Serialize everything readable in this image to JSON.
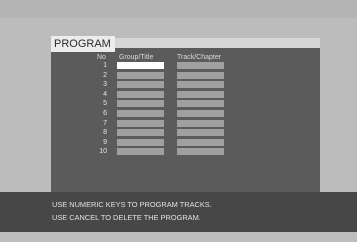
{
  "program": {
    "title": "PROGRAM",
    "columns": {
      "no": "No",
      "group_title": "Group/Title",
      "track_chapter": "Track/Chapter"
    },
    "rows": [
      {
        "no": "1",
        "group_title": "",
        "track_chapter": "",
        "selected": true
      },
      {
        "no": "2",
        "group_title": "",
        "track_chapter": "",
        "selected": false
      },
      {
        "no": "3",
        "group_title": "",
        "track_chapter": "",
        "selected": false
      },
      {
        "no": "4",
        "group_title": "",
        "track_chapter": "",
        "selected": false
      },
      {
        "no": "5",
        "group_title": "",
        "track_chapter": "",
        "selected": false
      },
      {
        "no": "6",
        "group_title": "",
        "track_chapter": "",
        "selected": false
      },
      {
        "no": "7",
        "group_title": "",
        "track_chapter": "",
        "selected": false
      },
      {
        "no": "8",
        "group_title": "",
        "track_chapter": "",
        "selected": false
      },
      {
        "no": "9",
        "group_title": "",
        "track_chapter": "",
        "selected": false
      },
      {
        "no": "10",
        "group_title": "",
        "track_chapter": "",
        "selected": false
      }
    ]
  },
  "messages": {
    "line1": "USE NUMERIC KEYS TO PROGRAM TRACKS.",
    "line2": "USE CANCEL TO DELETE THE PROGRAM."
  },
  "colors": {
    "panel": "#5b5b5b",
    "cell": "#a0a0a0",
    "cell_selected": "#ffffff",
    "message_bar": "#474747",
    "screen": "#bcbcbc"
  }
}
